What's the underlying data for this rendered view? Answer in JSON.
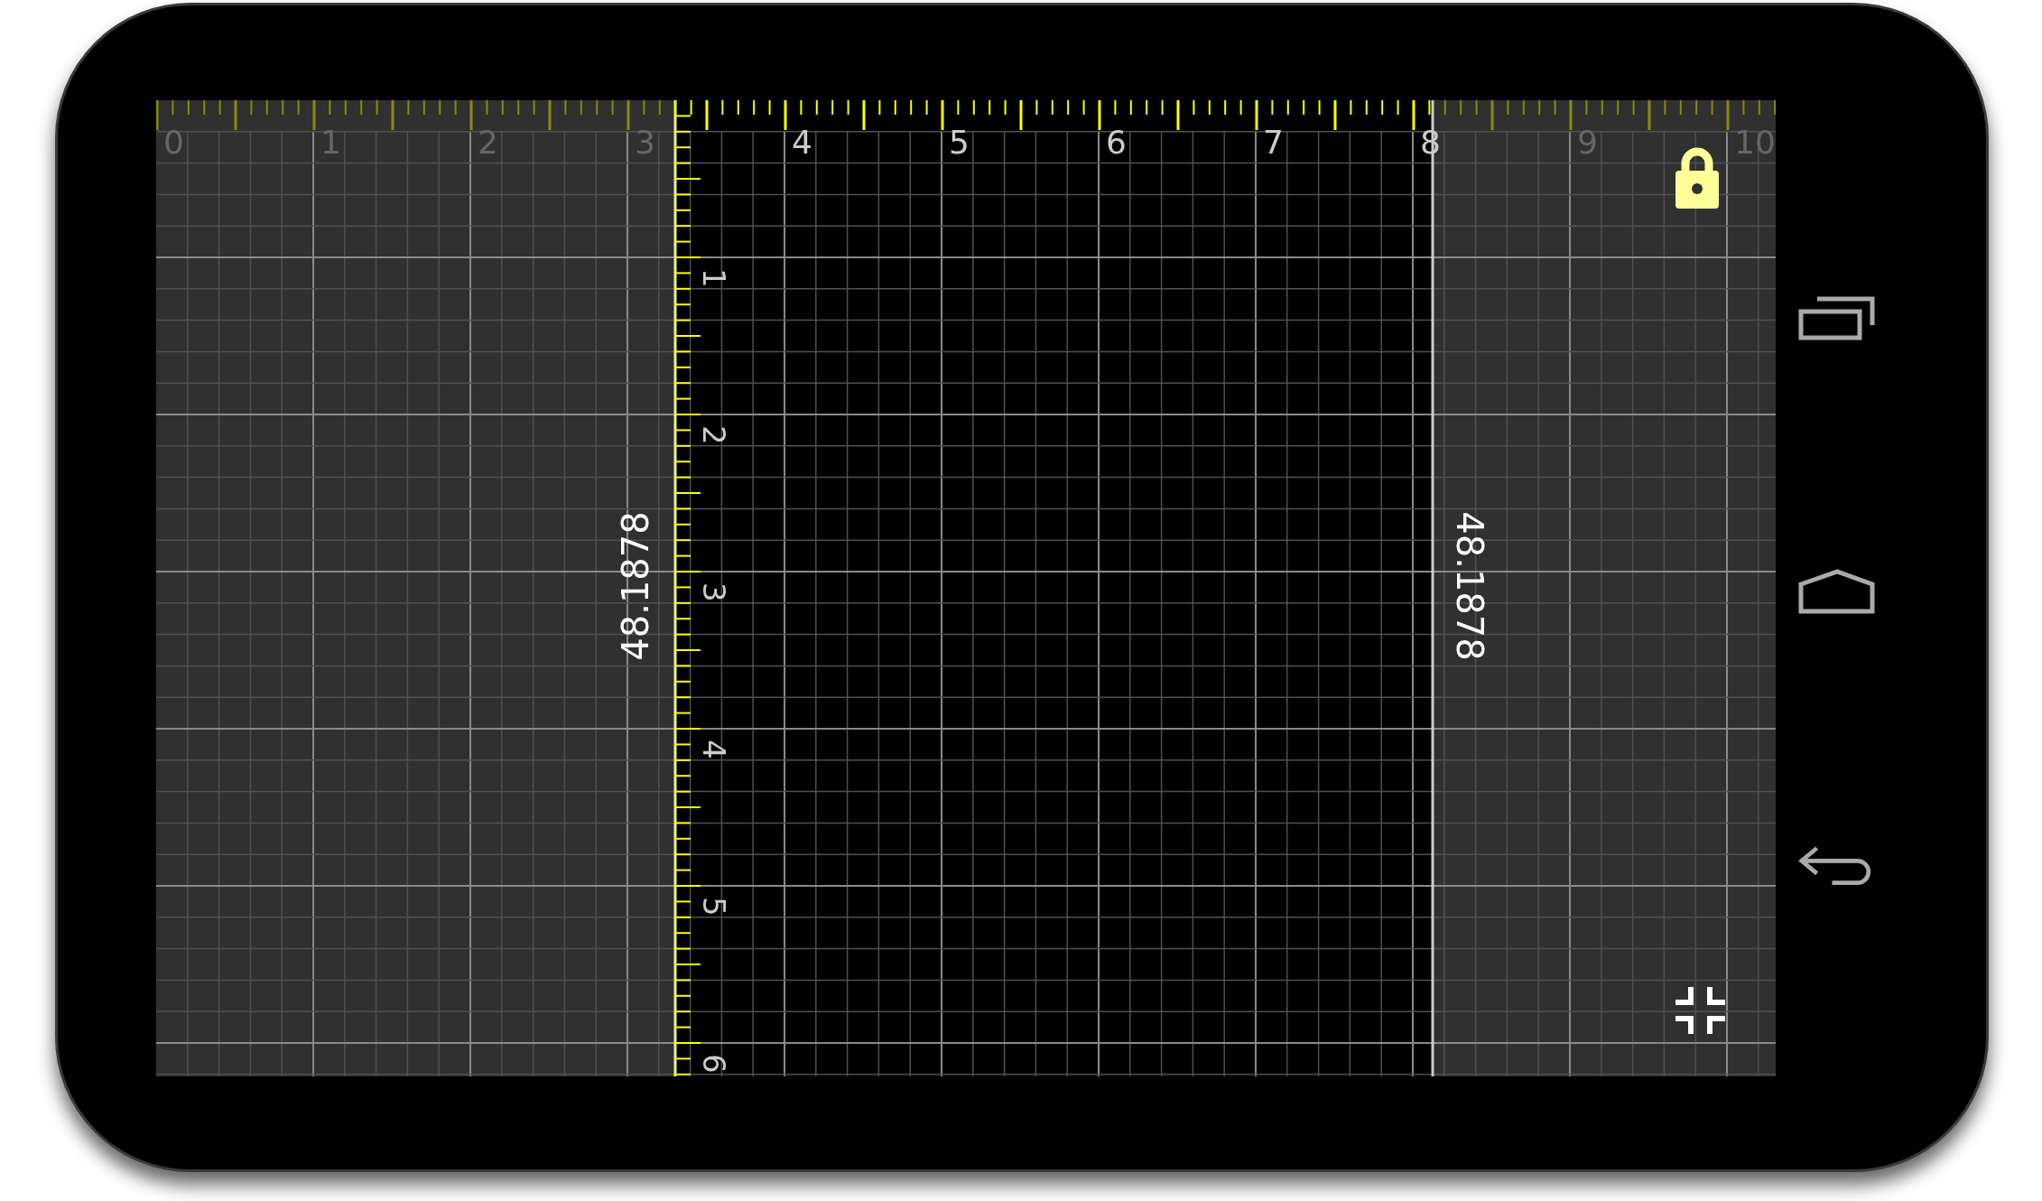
{
  "ruler": {
    "horizontal_labels": [
      "0",
      "1",
      "2",
      "3",
      "4",
      "5",
      "6",
      "7",
      "8",
      "9",
      "10"
    ],
    "vertical_labels": [
      "1",
      "2",
      "3",
      "4",
      "5",
      "6"
    ],
    "start_reading": "48.1878",
    "end_reading": "48.1878",
    "lock": {
      "locked": true
    }
  },
  "nav_buttons": [
    {
      "kind": "recent"
    },
    {
      "kind": "home"
    },
    {
      "kind": "back"
    }
  ]
}
